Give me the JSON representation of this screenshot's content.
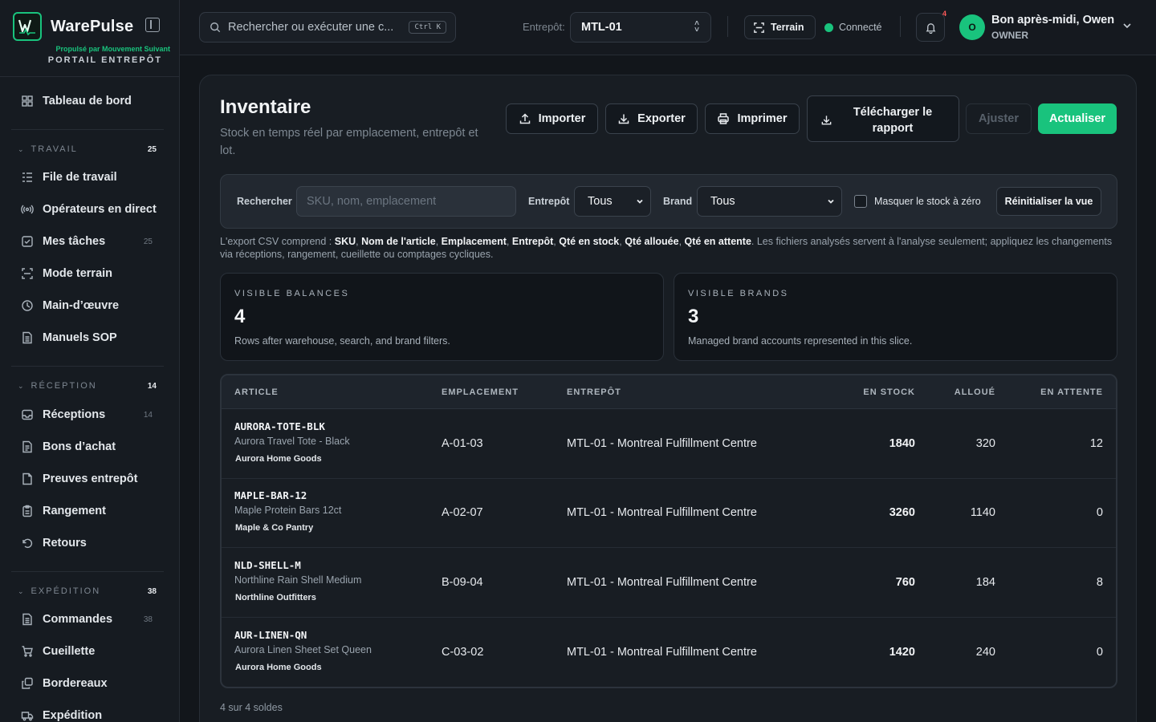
{
  "app": {
    "name": "WarePulse",
    "powered_by": "Propulsé par Mouvement Suivant",
    "portal": "PORTAIL ENTREPÔT"
  },
  "sidebar": {
    "dashboard": "Tableau de bord",
    "sections": [
      {
        "title": "TRAVAIL",
        "count": "25",
        "items": [
          {
            "label": "File de travail",
            "icon": "list-icon",
            "count": ""
          },
          {
            "label": "Opérateurs en direct",
            "icon": "broadcast-icon",
            "count": ""
          },
          {
            "label": "Mes tâches",
            "icon": "checkbox-icon",
            "count": "25"
          },
          {
            "label": "Mode terrain",
            "icon": "scan-icon",
            "count": ""
          },
          {
            "label": "Main-d’œuvre",
            "icon": "clock-icon",
            "count": ""
          },
          {
            "label": "Manuels SOP",
            "icon": "document-icon",
            "count": ""
          }
        ]
      },
      {
        "title": "RÉCEPTION",
        "count": "14",
        "items": [
          {
            "label": "Réceptions",
            "icon": "inbox-icon",
            "count": "14"
          },
          {
            "label": "Bons d’achat",
            "icon": "receipt-icon",
            "count": ""
          },
          {
            "label": "Preuves entrepôt",
            "icon": "file-icon",
            "count": ""
          },
          {
            "label": "Rangement",
            "icon": "clipboard-icon",
            "count": ""
          },
          {
            "label": "Retours",
            "icon": "return-icon",
            "count": ""
          }
        ]
      },
      {
        "title": "EXPÉDITION",
        "count": "38",
        "items": [
          {
            "label": "Commandes",
            "icon": "document-icon",
            "count": "38"
          },
          {
            "label": "Cueillette",
            "icon": "cart-icon",
            "count": ""
          },
          {
            "label": "Bordereaux",
            "icon": "copy-icon",
            "count": ""
          },
          {
            "label": "Expédition",
            "icon": "truck-icon",
            "count": ""
          }
        ]
      }
    ]
  },
  "topbar": {
    "search_placeholder": "Rechercher ou exécuter une c...",
    "shortcut": "Ctrl K",
    "warehouse_label": "Entrepôt:",
    "warehouse_value": "MTL-01",
    "terrain_label": "Terrain",
    "status": "Connecté",
    "notification_count": "4",
    "avatar_initial": "O",
    "greeting_prefix": "Bon après-midi, ",
    "greeting_name": "Owen",
    "role": "OWNER"
  },
  "page": {
    "title": "Inventaire",
    "subtitle": "Stock en temps réel par emplacement, entrepôt et lot.",
    "buttons": {
      "import": "Importer",
      "export": "Exporter",
      "print": "Imprimer",
      "download_report": "Télécharger le rapport",
      "adjust": "Ajuster",
      "refresh": "Actualiser"
    }
  },
  "filters": {
    "search_label": "Rechercher",
    "search_placeholder": "SKU, nom, emplacement",
    "warehouse_label": "Entrepôt",
    "warehouse_value": "Tous",
    "brand_label": "Brand",
    "brand_value": "Tous",
    "hide_zero_label": "Masquer le stock à zéro",
    "reset_label": "Réinitialiser la vue"
  },
  "note": {
    "prefix": "L'export CSV comprend : ",
    "fields": [
      "SKU",
      "Nom de l'article",
      "Emplacement",
      "Entrepôt",
      "Qté en stock",
      "Qté allouée",
      "Qté en attente"
    ],
    "suffix": ". Les fichiers analysés servent à l'analyse seulement; appliquez les changements via réceptions, rangement, cueillette ou comptages cycliques."
  },
  "stats": [
    {
      "label": "VISIBLE BALANCES",
      "value": "4",
      "desc": "Rows after warehouse, search, and brand filters."
    },
    {
      "label": "VISIBLE BRANDS",
      "value": "3",
      "desc": "Managed brand accounts represented in this slice."
    }
  ],
  "table": {
    "headers": {
      "article": "ARTICLE",
      "location": "EMPLACEMENT",
      "warehouse": "ENTREPÔT",
      "on_hand": "EN STOCK",
      "allocated": "ALLOUÉ",
      "pending": "EN ATTENTE"
    },
    "rows": [
      {
        "sku": "AURORA-TOTE-BLK",
        "name": "Aurora Travel Tote - Black",
        "brand": "Aurora Home Goods",
        "location": "A-01-03",
        "warehouse": "MTL-01 - Montreal Fulfillment Centre",
        "on_hand": "1840",
        "allocated": "320",
        "pending": "12"
      },
      {
        "sku": "MAPLE-BAR-12",
        "name": "Maple Protein Bars 12ct",
        "brand": "Maple & Co Pantry",
        "location": "A-02-07",
        "warehouse": "MTL-01 - Montreal Fulfillment Centre",
        "on_hand": "3260",
        "allocated": "1140",
        "pending": "0"
      },
      {
        "sku": "NLD-SHELL-M",
        "name": "Northline Rain Shell Medium",
        "brand": "Northline Outfitters",
        "location": "B-09-04",
        "warehouse": "MTL-01 - Montreal Fulfillment Centre",
        "on_hand": "760",
        "allocated": "184",
        "pending": "8"
      },
      {
        "sku": "AUR-LINEN-QN",
        "name": "Aurora Linen Sheet Set Queen",
        "brand": "Aurora Home Goods",
        "location": "C-03-02",
        "warehouse": "MTL-01 - Montreal Fulfillment Centre",
        "on_hand": "1420",
        "allocated": "240",
        "pending": "0"
      }
    ],
    "footer": "4 sur 4 soldes"
  }
}
